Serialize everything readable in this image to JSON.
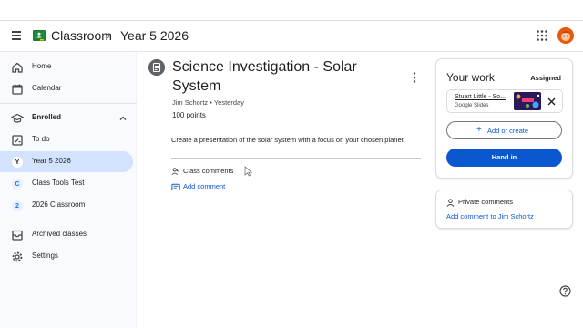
{
  "app": {
    "name": "Classroom",
    "breadcrumb": "Year 5 2026",
    "separator": "›"
  },
  "sidebar": {
    "items": [
      {
        "label": "Home",
        "icon": "home-icon"
      },
      {
        "label": "Calendar",
        "icon": "calendar-icon"
      }
    ],
    "section": {
      "label": "Enrolled",
      "icon": "school-icon",
      "expanded": true
    },
    "enrolled": [
      {
        "label": "To do",
        "icon": "todo-icon"
      },
      {
        "label": "Year 5 2026",
        "letter": "Y",
        "active": true
      },
      {
        "label": "Class Tools Test",
        "letter": "C"
      },
      {
        "label": "2026 Classroom",
        "letter": "2"
      }
    ],
    "footer": [
      {
        "label": "Archived classes",
        "icon": "archive-icon"
      },
      {
        "label": "Settings",
        "icon": "gear-icon"
      }
    ]
  },
  "assignment": {
    "title": "Science Investigation - Solar System",
    "author": "Jim Schortz",
    "posted": "Yesterday",
    "meta_separator": " • ",
    "points": "100 points",
    "description": "Create a presentation of the solar system with a focus on your chosen planet.",
    "class_comments_label": "Class comments",
    "add_comment_label": "Add comment"
  },
  "your_work": {
    "title": "Your work",
    "status": "Assigned",
    "attachment": {
      "name": "Stuart Little - So...",
      "type": "Google Slides"
    },
    "add_create_label": "Add or create",
    "hand_in_label": "Hand in"
  },
  "private_comments": {
    "title": "Private comments",
    "link": "Add comment to Jim Schortz"
  },
  "colors": {
    "accent": "#0b57d0",
    "active_nav": "#d3e3fd",
    "logo_green": "#188038",
    "logo_yellow": "#fbbc04"
  }
}
